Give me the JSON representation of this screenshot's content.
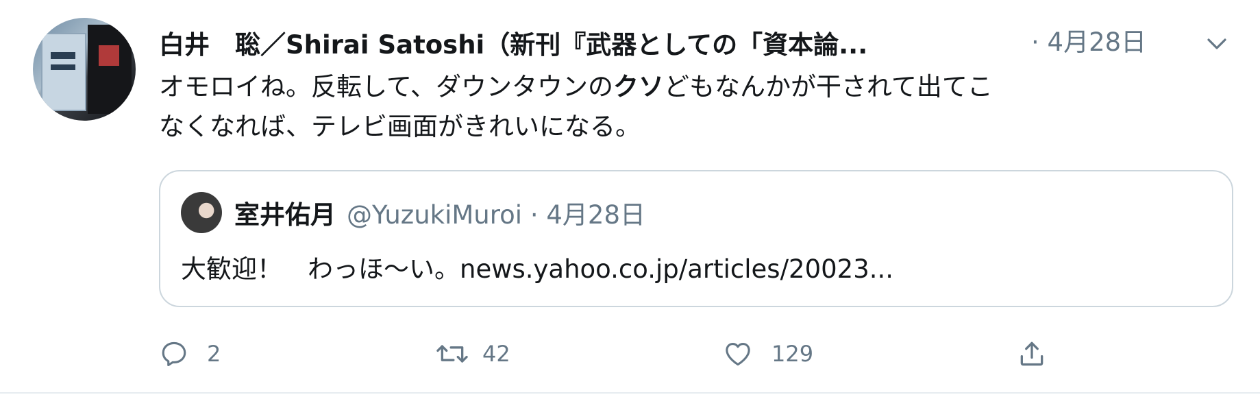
{
  "tweet": {
    "author_display_name": "白井　聡／Shirai Satoshi（新刊『武器としての「資本論...",
    "date": "· 4月28日",
    "text_line1_pre": "オモロイね。反転して、ダウンタウンの",
    "text_bold": "クソ",
    "text_line1_post": "どもなんかが干されて出てこ",
    "text_line2": "なくなれば、テレビ画面がきれいになる。",
    "avatar_icon": "book-cover-avatar",
    "menu_icon": "chevron-down-icon"
  },
  "quoted_tweet": {
    "author_display_name": "室井佑月",
    "handle_date": "@YuzukiMuroi · 4月28日",
    "text": "大歓迎！　わっほ〜い。news.yahoo.co.jp/articles/20023..."
  },
  "actions": {
    "reply_count": "2",
    "retweet_count": "42",
    "like_count": "129",
    "reply_icon": "reply-icon",
    "retweet_icon": "retweet-icon",
    "like_icon": "heart-icon",
    "share_icon": "share-icon"
  },
  "colors": {
    "text": "#14171a",
    "secondary": "#657786",
    "border": "#ccd6dd"
  }
}
